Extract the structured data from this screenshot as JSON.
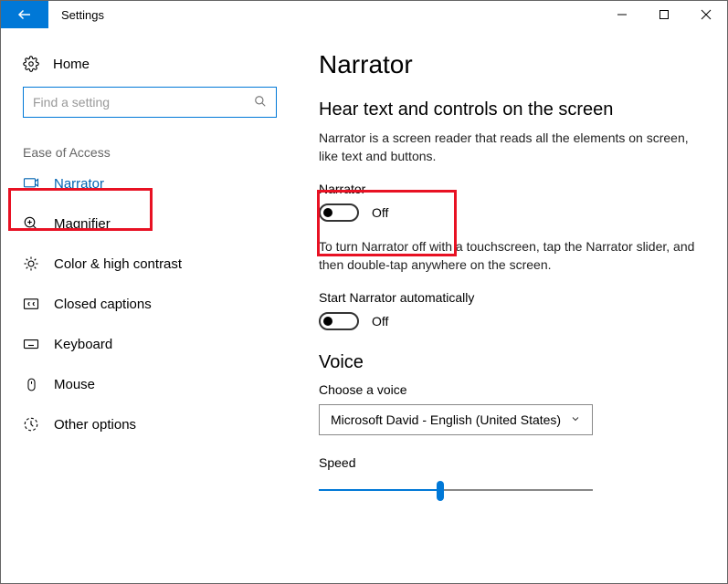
{
  "window": {
    "title": "Settings"
  },
  "sidebar": {
    "home_label": "Home",
    "search_placeholder": "Find a setting",
    "category_label": "Ease of Access",
    "items": [
      {
        "label": "Narrator"
      },
      {
        "label": "Magnifier"
      },
      {
        "label": "Color & high contrast"
      },
      {
        "label": "Closed captions"
      },
      {
        "label": "Keyboard"
      },
      {
        "label": "Mouse"
      },
      {
        "label": "Other options"
      }
    ]
  },
  "content": {
    "page_title": "Narrator",
    "subtitle": "Hear text and controls on the screen",
    "description": "Narrator is a screen reader that reads all the elements on screen, like text and buttons.",
    "narrator_toggle": {
      "label": "Narrator",
      "state": "Off"
    },
    "touchscreen_hint": "To turn Narrator off with a touchscreen, tap the Narrator slider, and then double-tap anywhere on the screen.",
    "auto_toggle": {
      "label": "Start Narrator automatically",
      "state": "Off"
    },
    "voice": {
      "heading": "Voice",
      "choose_label": "Choose a voice",
      "selected": "Microsoft David - English (United States)",
      "speed_label": "Speed"
    }
  }
}
